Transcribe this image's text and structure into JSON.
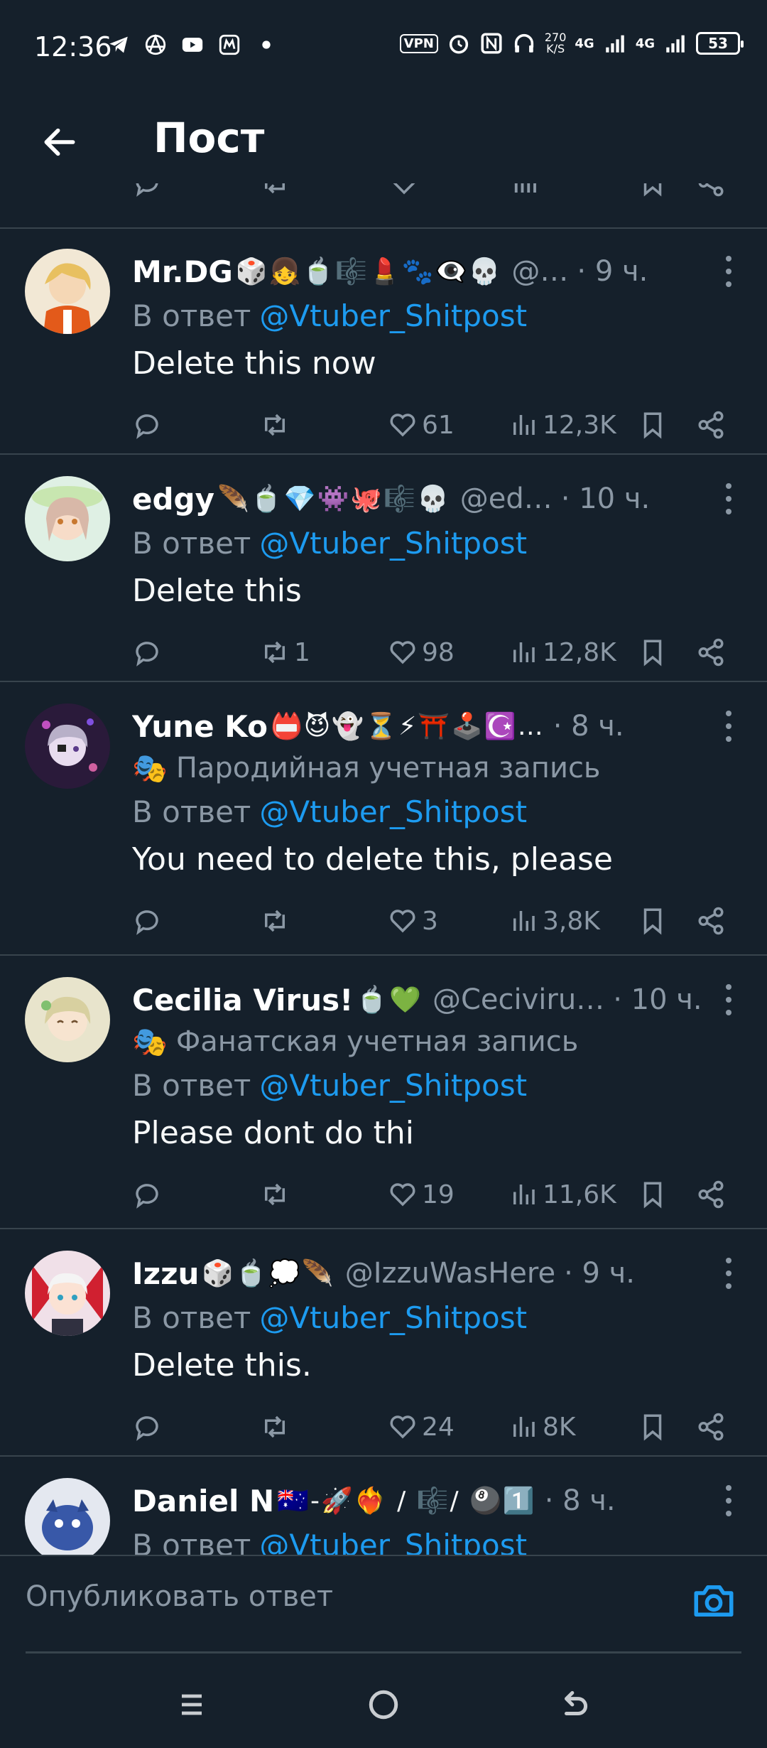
{
  "status_bar": {
    "time": "12:36",
    "vpn": "VPN",
    "speed_top": "270",
    "speed_bottom": "K/S",
    "net1": "4G",
    "net2": "4G",
    "battery": "53"
  },
  "header": {
    "title": "Пост"
  },
  "compose": {
    "placeholder": "Опубликовать ответ"
  },
  "replies": [
    {
      "name": "Mr.DG",
      "emojis": "🎲👧🍵🎼💄🐾👁‍🗨💀",
      "handle": "@…",
      "time": "· 9 ч.",
      "badge": "",
      "reply_prefix": "В ответ",
      "mention": "@Vtuber_Shitpost",
      "text": "Delete this now",
      "likes": "61",
      "retweets": "",
      "views": "12,3K"
    },
    {
      "name": "edgy",
      "emojis": "🪶🍵💎👾🐙🎼💀",
      "handle": "@ed…",
      "time": "· 10 ч.",
      "badge": "",
      "reply_prefix": "В ответ",
      "mention": "@Vtuber_Shitpost",
      "text": "Delete this",
      "likes": "98",
      "retweets": "1",
      "views": "12,8K"
    },
    {
      "name": "Yune Ko",
      "emojis": "📛😈👻⏳⚡⛩️🕹️☪️…",
      "handle": "",
      "time": "· 8 ч.",
      "badge": "Пародийная учетная запись",
      "reply_prefix": "В ответ",
      "mention": "@Vtuber_Shitpost",
      "text": "You need to delete this, please",
      "likes": "3",
      "retweets": "",
      "views": "3,8K"
    },
    {
      "name": "Cecilia Virus!",
      "emojis": "🍵💚",
      "handle": "@Ceciviru…",
      "time": "· 10 ч.",
      "badge": "Фанатская учетная запись",
      "reply_prefix": "В ответ",
      "mention": "@Vtuber_Shitpost",
      "text": "Please dont do thi",
      "likes": "19",
      "retweets": "",
      "views": "11,6K"
    },
    {
      "name": "Izzu",
      "emojis": "🎲🍵💭🪶",
      "handle": "@IzzuWasHere",
      "time": "· 9 ч.",
      "badge": "",
      "reply_prefix": "В ответ",
      "mention": "@Vtuber_Shitpost",
      "text": "Delete this.",
      "likes": "24",
      "retweets": "",
      "views": "8K"
    },
    {
      "name": "Daniel N",
      "emojis": "🇦🇺-🚀❤️‍🔥 / 🎼/ 🎱1️⃣",
      "handle": "",
      "time": "· 8 ч.",
      "badge": "",
      "reply_prefix": "В ответ",
      "mention": "@Vtuber_Shitpost",
      "text": "",
      "likes": "",
      "retweets": "",
      "views": ""
    }
  ],
  "colors": {
    "background": "#15202b",
    "divider": "#38444d",
    "secondary_text": "#8b98a5",
    "accent": "#1d9bf0"
  },
  "icons": {
    "reply": "speech-bubble-icon",
    "retweet": "retweet-icon",
    "like": "heart-icon",
    "views": "bar-chart-icon",
    "bookmark": "bookmark-icon",
    "share": "share-icon",
    "more": "vertical-dots-icon",
    "mask": "mask-icon",
    "camera": "camera-icon"
  }
}
